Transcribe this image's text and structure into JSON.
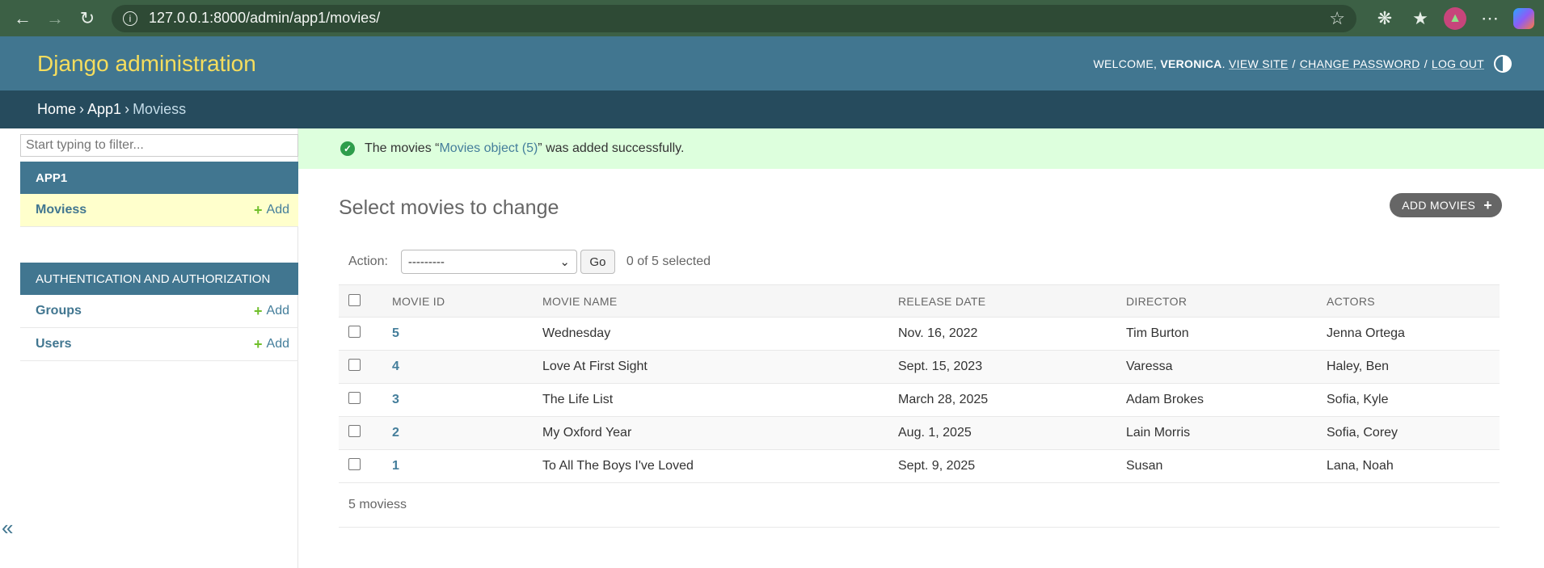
{
  "browser": {
    "url": "127.0.0.1:8000/admin/app1/movies/",
    "back_icon": "back-arrow-icon",
    "forward_icon": "forward-arrow-icon",
    "reload_icon": "reload-icon"
  },
  "header": {
    "branding": "Django administration",
    "welcome": "WELCOME,",
    "username": "VERONICA",
    "view_site": "VIEW SITE",
    "change_password": "CHANGE PASSWORD",
    "log_out": "LOG OUT"
  },
  "breadcrumbs": {
    "home": "Home",
    "app": "App1",
    "current": "Moviess"
  },
  "sidebar": {
    "filter_placeholder": "Start typing to filter...",
    "modules": [
      {
        "caption": "APP1",
        "models": [
          {
            "name": "Moviess",
            "add": "Add"
          }
        ]
      },
      {
        "caption": "AUTHENTICATION AND AUTHORIZATION",
        "models": [
          {
            "name": "Groups",
            "add": "Add"
          },
          {
            "name": "Users",
            "add": "Add"
          }
        ]
      }
    ],
    "collapse": "«"
  },
  "message": {
    "prefix": "The movies “",
    "link": "Movies object (5)",
    "suffix": "” was added successfully."
  },
  "content": {
    "title": "Select movies to change",
    "add_button": "ADD MOVIES",
    "action_label": "Action:",
    "action_selected": "---------",
    "go": "Go",
    "selected_count": "0 of 5 selected",
    "columns": [
      "MOVIE ID",
      "MOVIE NAME",
      "RELEASE DATE",
      "DIRECTOR",
      "ACTORS"
    ],
    "rows": [
      {
        "id": "5",
        "name": "Wednesday",
        "date": "Nov. 16, 2022",
        "director": "Tim Burton",
        "actors": "Jenna Ortega"
      },
      {
        "id": "4",
        "name": "Love At First Sight",
        "date": "Sept. 15, 2023",
        "director": "Varessa",
        "actors": "Haley, Ben"
      },
      {
        "id": "3",
        "name": "The Life List",
        "date": "March 28, 2025",
        "director": "Adam Brokes",
        "actors": "Sofia, Kyle"
      },
      {
        "id": "2",
        "name": "My Oxford Year",
        "date": "Aug. 1, 2025",
        "director": "Lain Morris",
        "actors": "Sofia, Corey"
      },
      {
        "id": "1",
        "name": "To All The Boys I've Loved",
        "date": "Sept. 9, 2025",
        "director": "Susan",
        "actors": "Lana, Noah"
      }
    ],
    "paginator": "5 moviess"
  },
  "colors": {
    "header": "#417690",
    "breadcrumbs": "#264b5d",
    "branding": "#f5dd5d",
    "success": "#ddffdd"
  }
}
